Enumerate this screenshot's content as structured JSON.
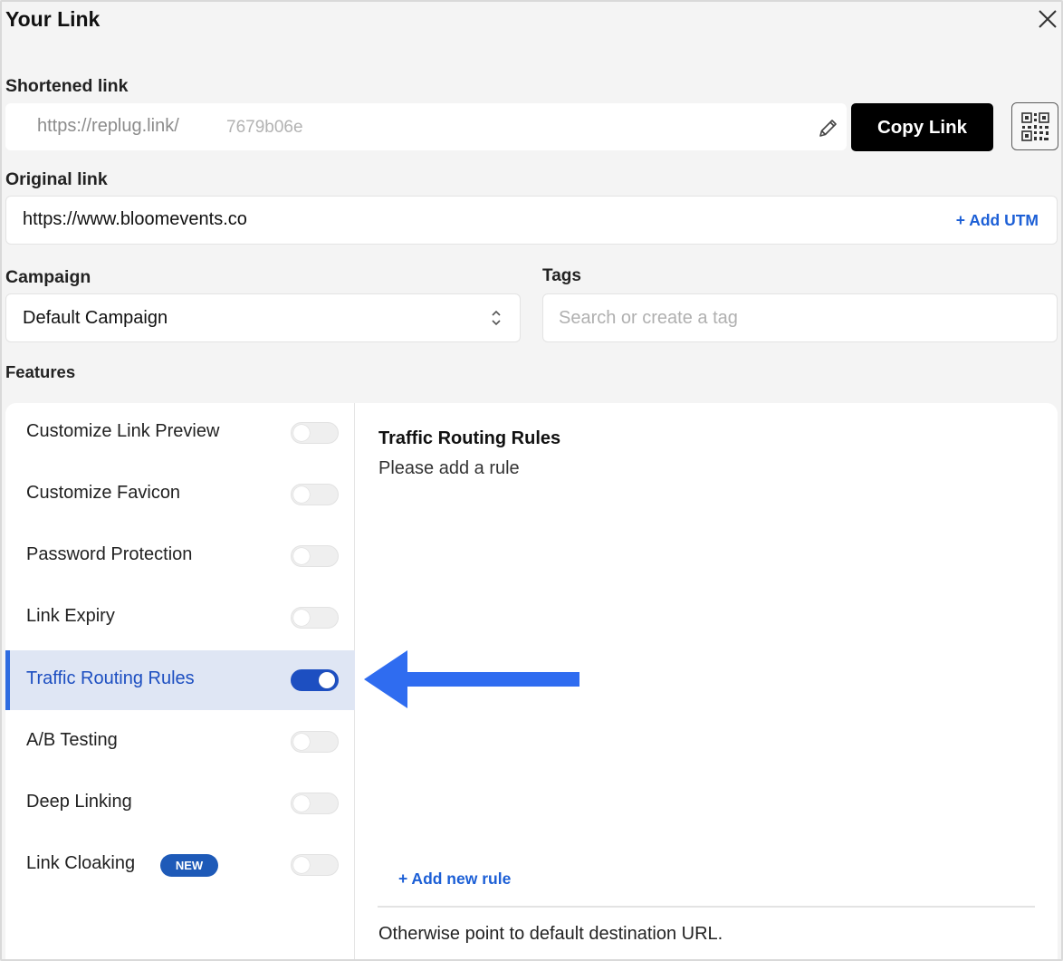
{
  "modal": {
    "title": "Your Link",
    "close_icon": "close-icon"
  },
  "shortened": {
    "label": "Shortened link",
    "prefix": "https://replug.link/",
    "slug": "7679b06e",
    "edit_icon": "pencil-icon",
    "copy_label": "Copy Link",
    "qr_icon": "qr-code-icon"
  },
  "original": {
    "label": "Original link",
    "value": "https://www.bloomevents.co",
    "add_utm": "+ Add UTM"
  },
  "campaign": {
    "label": "Campaign",
    "value": "Default Campaign"
  },
  "tags": {
    "label": "Tags",
    "placeholder": "Search or create a tag"
  },
  "features": {
    "label": "Features",
    "items": [
      {
        "label": "Customize Link Preview",
        "enabled": false
      },
      {
        "label": "Customize Favicon",
        "enabled": false
      },
      {
        "label": "Password Protection",
        "enabled": false
      },
      {
        "label": "Link Expiry",
        "enabled": false
      },
      {
        "label": "Traffic Routing Rules",
        "enabled": true
      },
      {
        "label": "A/B Testing",
        "enabled": false
      },
      {
        "label": "Deep Linking",
        "enabled": false
      },
      {
        "label": "Link Cloaking",
        "enabled": false,
        "badge": "NEW"
      }
    ]
  },
  "detail": {
    "title": "Traffic Routing Rules",
    "subtitle": "Please add a rule",
    "add_rule": "+ Add new rule",
    "footer": "Otherwise point to default destination URL."
  },
  "colors": {
    "accent": "#1d4fc1",
    "link": "#1c5fd6",
    "annotation_arrow": "#2f6cf0"
  }
}
